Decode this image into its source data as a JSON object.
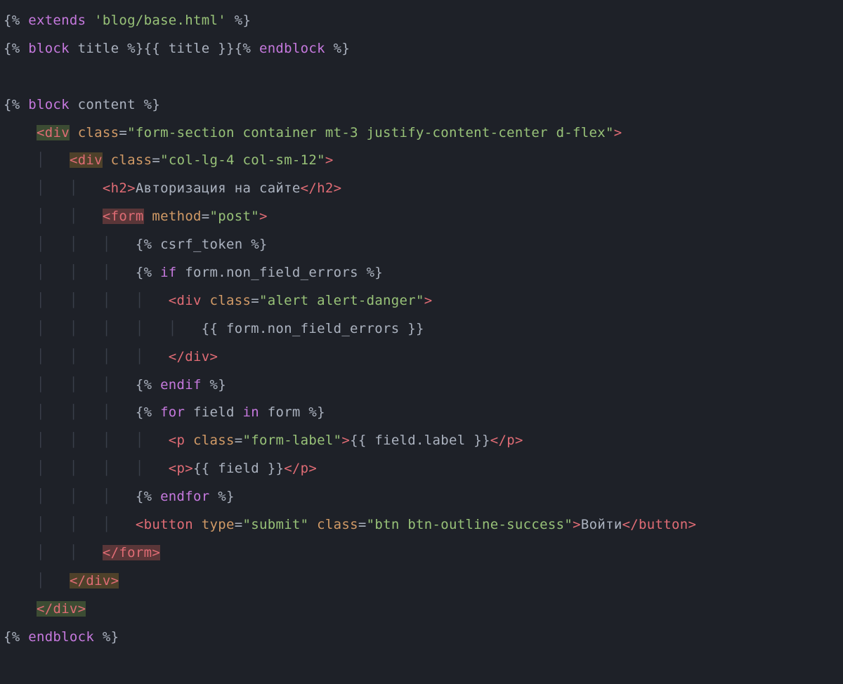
{
  "lines": {
    "l1": {
      "extends": "extends",
      "fname": "'blog/base.html'"
    },
    "l2": {
      "block": "block",
      "title": "title",
      "varTitle": "title",
      "endblock": "endblock"
    },
    "l4": {
      "block": "block",
      "content": "content"
    },
    "l5": {
      "tagOpen": "<",
      "div": "div",
      "classAttr": "class",
      "eq": "=",
      "classVal": "\"form-section container mt-3 justify-content-center d-flex\"",
      "close": ">"
    },
    "l6": {
      "div": "div",
      "classAttr": "class",
      "classVal": "\"col-lg-4 col-sm-12\""
    },
    "l7": {
      "h2": "h2",
      "text": "Авторизация на сайте"
    },
    "l8": {
      "form": "form",
      "method": "method",
      "post": "\"post\""
    },
    "l9": {
      "csrf": "csrf_token"
    },
    "l10": {
      "kif": "if",
      "cond": "form.non_field_errors"
    },
    "l11": {
      "div": "div",
      "classAttr": "class",
      "classVal": "\"alert alert-danger\""
    },
    "l12": {
      "expr": "form.non_field_errors"
    },
    "l13": {
      "div": "div"
    },
    "l14": {
      "endif": "endif"
    },
    "l15": {
      "kfor": "for",
      "field": "field",
      "kin": "in",
      "form": "form"
    },
    "l16": {
      "p": "p",
      "classAttr": "class",
      "classVal": "\"form-label\"",
      "expr": "field.label"
    },
    "l17": {
      "p": "p",
      "expr": "field"
    },
    "l18": {
      "endfor": "endfor"
    },
    "l19": {
      "button": "button",
      "type": "type",
      "submit": "\"submit\"",
      "classAttr": "class",
      "classVal": "\"btn btn-outline-success\"",
      "text": "Войти"
    },
    "l20": {
      "form": "form"
    },
    "l21": {
      "div": "div"
    },
    "l22": {
      "div": "div"
    },
    "l23": {
      "endblock": "endblock"
    }
  }
}
